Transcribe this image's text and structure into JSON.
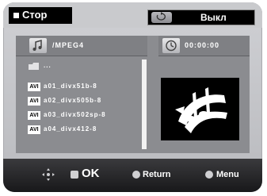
{
  "header": {
    "mode_label": "Стор",
    "repeat_label": "Выкл"
  },
  "browser": {
    "folder_title": "/MPEG4",
    "time": "00:00:00",
    "items": [
      {
        "icon": "folder-up-icon",
        "label": "..."
      },
      {
        "icon": "avi-file-icon",
        "badge": "AVI",
        "label": "a01_divx51b-8"
      },
      {
        "icon": "avi-file-icon",
        "badge": "AVI",
        "label": "a02_divx505b-8"
      },
      {
        "icon": "avi-file-icon",
        "badge": "AVI",
        "label": "a03_divx502sp-8"
      },
      {
        "icon": "avi-file-icon",
        "badge": "AVI",
        "label": "a04_divx412-8"
      }
    ]
  },
  "footer": {
    "ok_label": "OK",
    "return_label": "Return",
    "menu_label": "Menu"
  }
}
